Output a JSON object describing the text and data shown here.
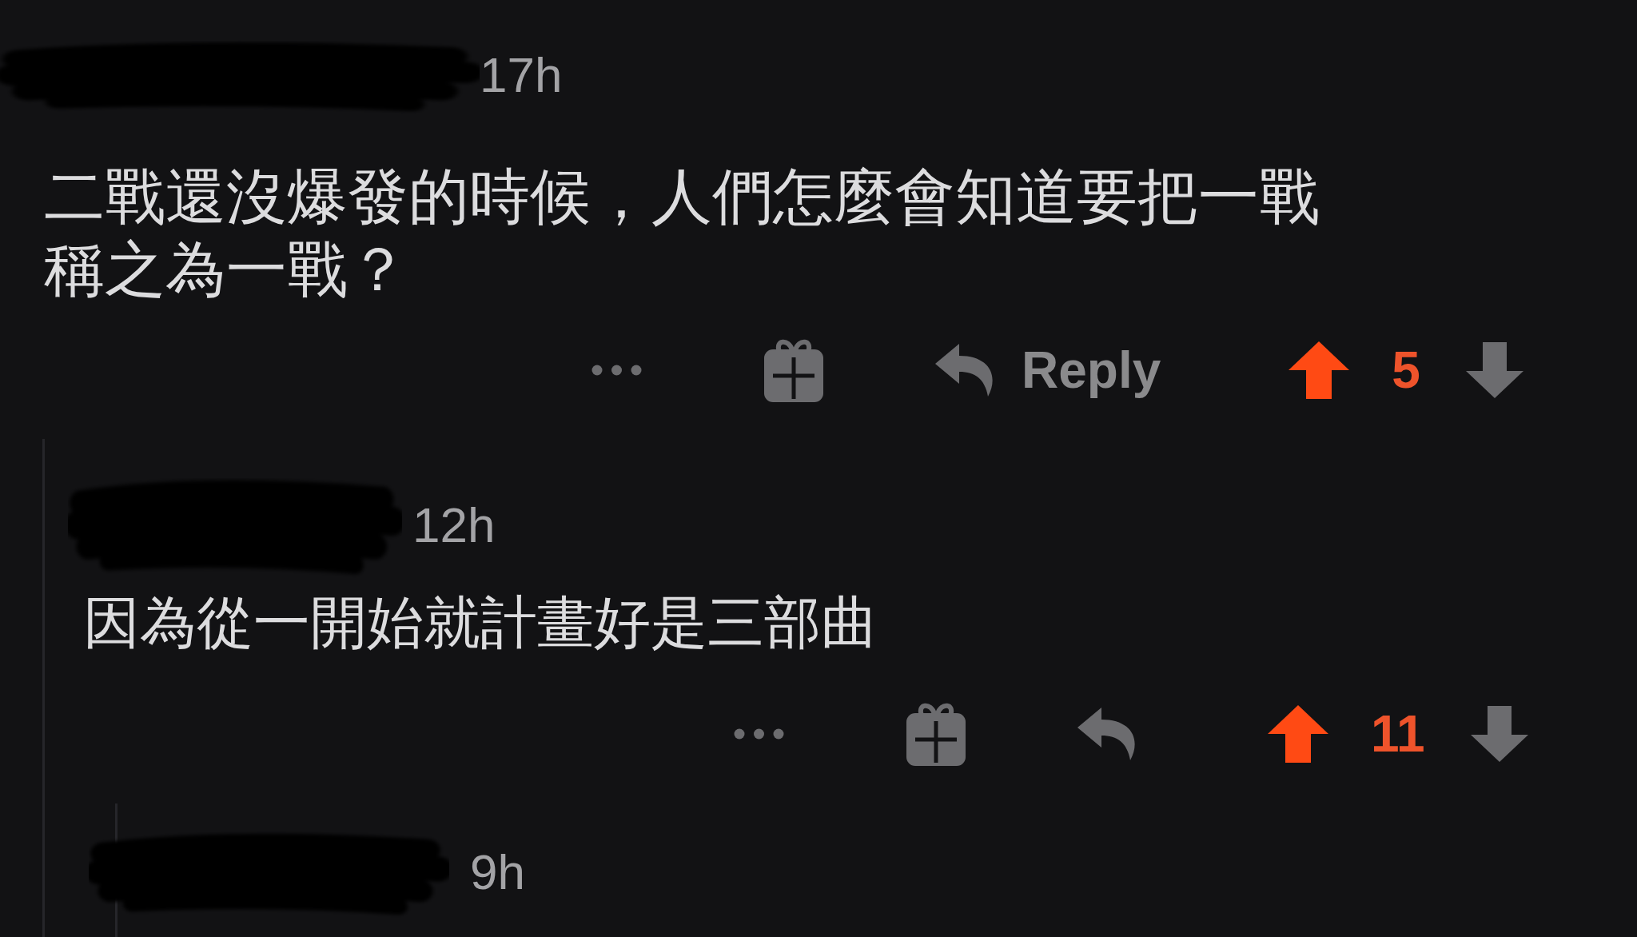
{
  "comments": [
    {
      "time": "17h",
      "body": "二戰還沒爆發的時候，人們怎麼會知道要把一戰稱之為一戰？",
      "reply_label": "Reply",
      "score": "5",
      "upvoted": true,
      "downvoted": false,
      "children": [
        {
          "time": "12h",
          "body": "因為從一開始就計畫好是三部曲",
          "score": "11",
          "upvoted": true,
          "downvoted": false,
          "children": [
            {
              "time": "9h"
            }
          ]
        }
      ]
    }
  ]
}
